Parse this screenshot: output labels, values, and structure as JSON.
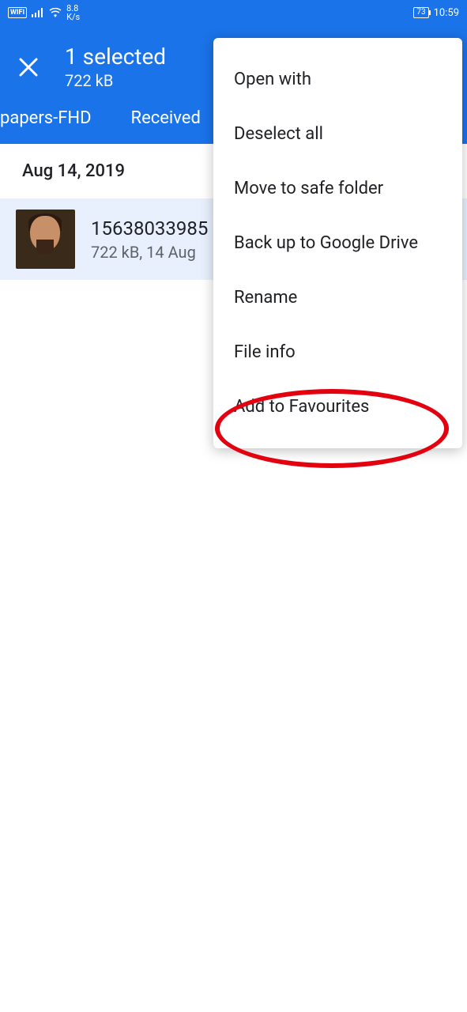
{
  "statusbar": {
    "wifi_label": "WIFI",
    "speed_num": "8.8",
    "speed_unit": "K/s",
    "battery": "73",
    "time": "10:59"
  },
  "header": {
    "title": "1 selected",
    "subtitle": "722 kB"
  },
  "tabs": {
    "left": "papers-FHD",
    "right": "Received"
  },
  "content": {
    "date_header": "Aug 14, 2019",
    "file": {
      "name": "15638033985",
      "meta": "722 kB, 14 Aug"
    }
  },
  "menu": {
    "open_with": "Open with",
    "deselect_all": "Deselect all",
    "move_safe": "Move to safe folder",
    "backup": "Back up to Google Drive",
    "rename": "Rename",
    "file_info": "File info",
    "add_fav": "Add to Favourites"
  }
}
